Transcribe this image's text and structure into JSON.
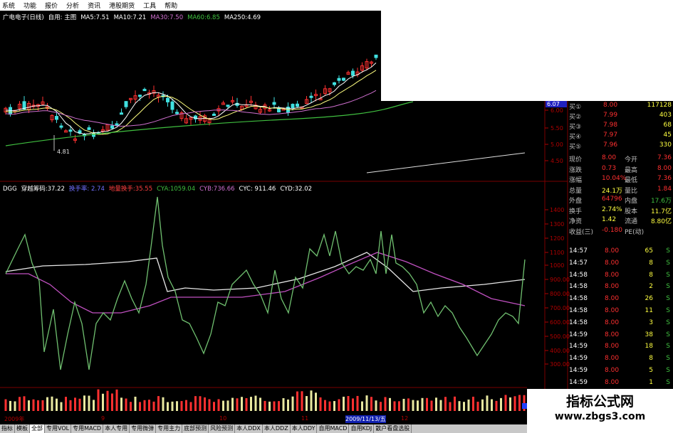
{
  "menu": [
    "系统",
    "功能",
    "报价",
    "分析",
    "资讯",
    "港股期货",
    "工具",
    "帮助"
  ],
  "price_chart": {
    "title_items": [
      {
        "text": "广电电子(日线)",
        "color": "#ffffff"
      },
      {
        "text": "自用: 主图",
        "color": "#ffffff"
      },
      {
        "text": "MA5:7.51",
        "color": "#ffffff"
      },
      {
        "text": "MA10:7.21",
        "color": "#ffffff"
      },
      {
        "text": "MA30:7.50",
        "color": "#d070d0"
      },
      {
        "text": "MA60:6.85",
        "color": "#40c040"
      },
      {
        "text": "MA250:4.69",
        "color": "#ffffff"
      }
    ],
    "y_ticks": [
      "6.00",
      "5.50",
      "5.00",
      "4.50"
    ],
    "top_price": "6.07",
    "low_mark": "4.81"
  },
  "indicator": {
    "title_items": [
      {
        "text": "DGG",
        "color": "#ffffff"
      },
      {
        "text": "穿越筹码:37.22",
        "color": "#ffffff"
      },
      {
        "text": "换手率: 2.74",
        "color": "#7070ff"
      },
      {
        "text": "地量换手:35.55",
        "color": "#ff4040"
      },
      {
        "text": "CYA:1059.04",
        "color": "#40c040"
      },
      {
        "text": "CYB:736.66",
        "color": "#d070d0"
      },
      {
        "text": "CYC: 911.46",
        "color": "#ffffff"
      },
      {
        "text": "CYD:32.02",
        "color": "#ffffff"
      }
    ],
    "y_ticks": [
      "1400",
      "1300",
      "1200",
      "1100",
      "1000",
      "900.00",
      "800.00",
      "700.00",
      "600.00",
      "500.00",
      "400.00",
      "300.00"
    ]
  },
  "quote": {
    "bids": [
      {
        "label": "买①",
        "price": "8.00",
        "vol": "117128"
      },
      {
        "label": "买②",
        "price": "7.99",
        "vol": "403"
      },
      {
        "label": "买③",
        "price": "7.98",
        "vol": "68"
      },
      {
        "label": "买④",
        "price": "7.97",
        "vol": "45"
      },
      {
        "label": "买⑤",
        "price": "7.96",
        "vol": "330"
      }
    ],
    "stats": [
      {
        "l1": "现价",
        "v1": "8.00",
        "l2": "今开",
        "v2": "7.36"
      },
      {
        "l1": "涨跌",
        "v1": "0.73",
        "l2": "最高",
        "v2": "8.00"
      },
      {
        "l1": "涨幅",
        "v1": "10.04%",
        "l2": "最低",
        "v2": "7.36"
      },
      {
        "l1": "总量",
        "v1": "24.1万",
        "l2": "量比",
        "v2": "1.84"
      },
      {
        "l1": "外盘",
        "v1": "64796",
        "l2": "内盘",
        "v2": "17.6万"
      },
      {
        "l1": "换手",
        "v1": "2.74%",
        "l2": "股本",
        "v2": "11.7亿"
      },
      {
        "l1": "净资",
        "v1": "1.42",
        "l2": "流通",
        "v2": "8.80亿"
      },
      {
        "l1": "收益(三)",
        "v1": "-0.180",
        "l2": "PE(动)",
        "v2": ""
      }
    ],
    "ticks": [
      {
        "time": "14:57",
        "price": "8.00",
        "vol": "65",
        "side": "S"
      },
      {
        "time": "14:57",
        "price": "8.00",
        "vol": "8",
        "side": "S"
      },
      {
        "time": "14:58",
        "price": "8.00",
        "vol": "8",
        "side": "S"
      },
      {
        "time": "14:58",
        "price": "8.00",
        "vol": "2",
        "side": "S"
      },
      {
        "time": "14:58",
        "price": "8.00",
        "vol": "26",
        "side": "S"
      },
      {
        "time": "14:58",
        "price": "8.00",
        "vol": "11",
        "side": "S"
      },
      {
        "time": "14:58",
        "price": "8.00",
        "vol": "3",
        "side": "S"
      },
      {
        "time": "14:59",
        "price": "8.00",
        "vol": "38",
        "side": "S"
      },
      {
        "time": "14:59",
        "price": "8.00",
        "vol": "18",
        "side": "S"
      },
      {
        "time": "14:59",
        "price": "8.00",
        "vol": "8",
        "side": "S"
      },
      {
        "time": "14:59",
        "price": "8.00",
        "vol": "5",
        "side": "S"
      },
      {
        "time": "14:59",
        "price": "8.00",
        "vol": "1",
        "side": "S"
      },
      {
        "time": "14:59",
        "price": "8.00",
        "vol": "1",
        "side": "S"
      },
      {
        "time": "14:59",
        "price": "8.00",
        "vol": "5",
        "side": "S"
      }
    ]
  },
  "date_axis": [
    "2009年",
    "9",
    "10",
    "11",
    "2009/11/13/五",
    "12"
  ],
  "tabs": [
    "指标",
    "模板",
    "全部",
    "专用VOL",
    "专用MACD",
    "本人专用",
    "专用微弹",
    "专用主力",
    "底部预测",
    "风险预测",
    "本人DDX",
    "本人DDZ",
    "本人DDY",
    "自用MACD",
    "自用KDJ",
    "散户看盘选股"
  ],
  "active_tab": 2,
  "watermark": {
    "title": "指标公式网",
    "url": "www.zbgs3.com"
  }
}
